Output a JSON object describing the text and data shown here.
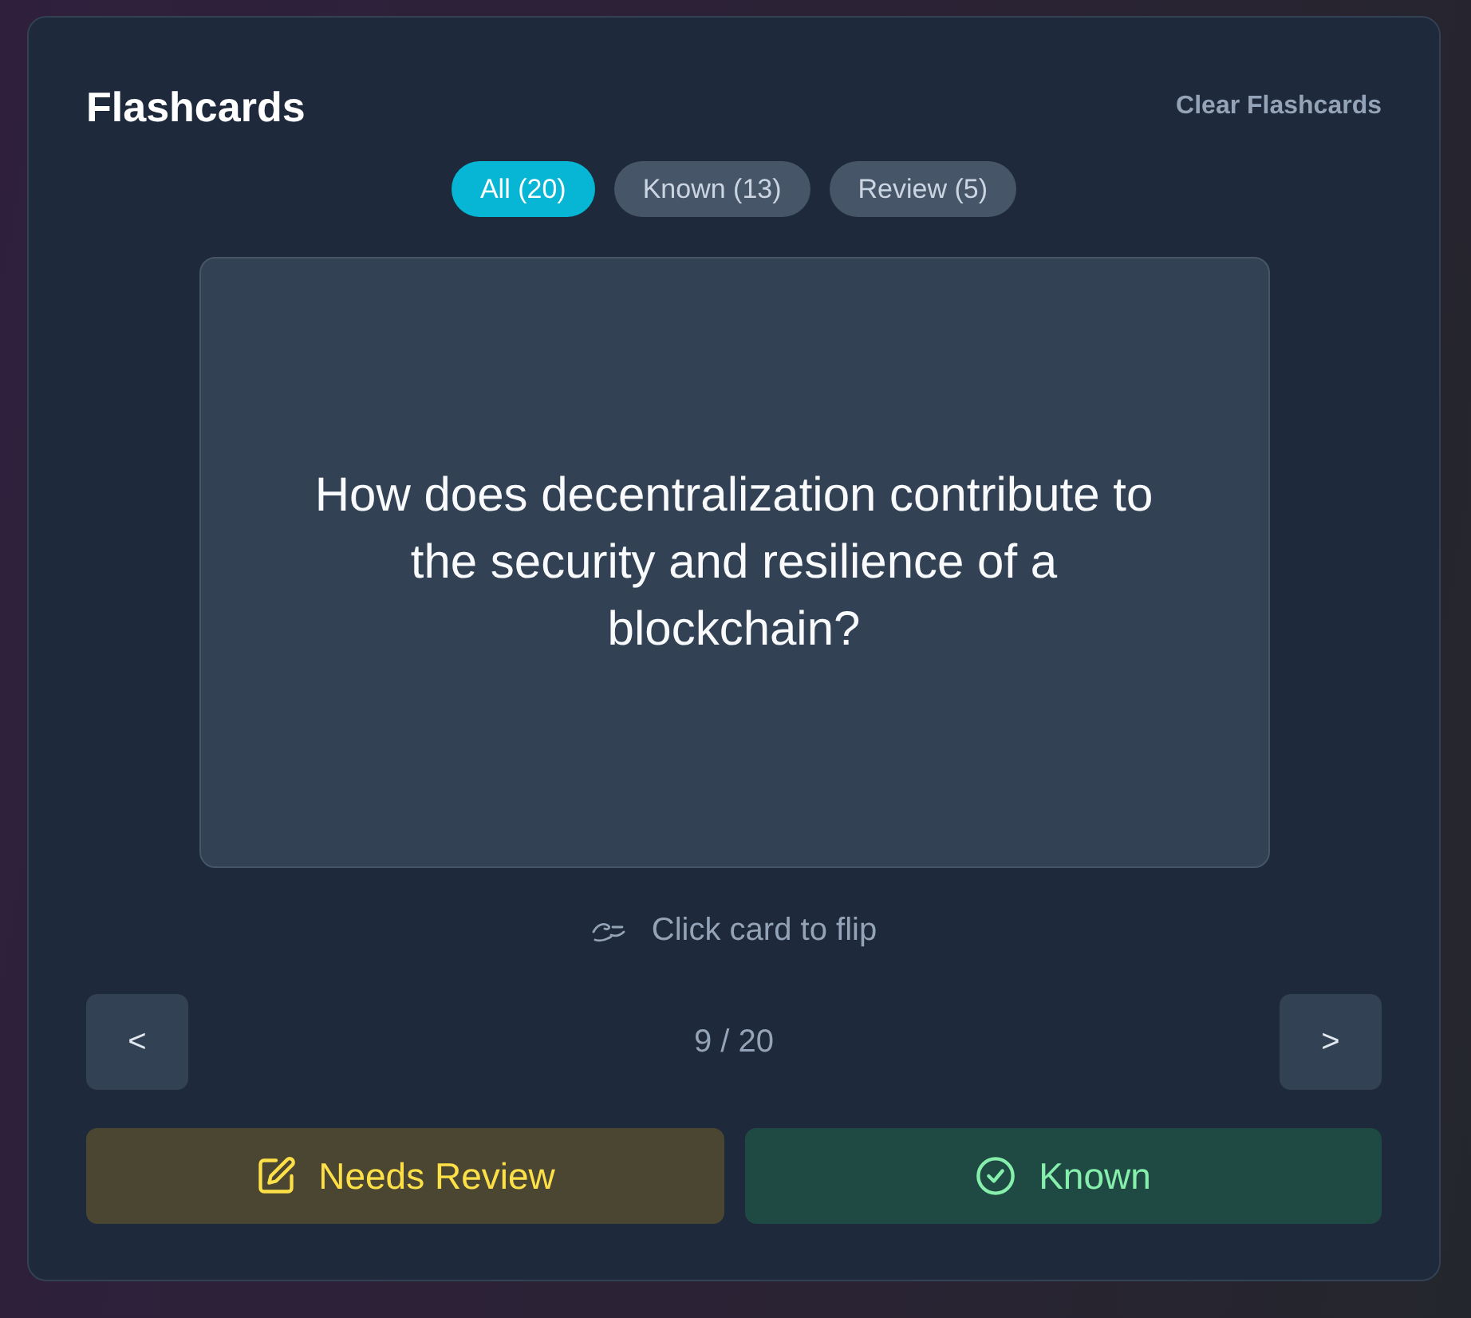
{
  "header": {
    "title": "Flashcards",
    "clear_button": "Clear Flashcards"
  },
  "filters": [
    {
      "label": "All (20)",
      "selected": true
    },
    {
      "label": "Known (13)",
      "selected": false
    },
    {
      "label": "Review (5)",
      "selected": false
    }
  ],
  "card": {
    "question": "How does decentralization contribute to the security and resilience of a blockchain?"
  },
  "flip_hint": "Click card to flip",
  "navigation": {
    "previous": "<",
    "counter": "9 / 20",
    "next": ">"
  },
  "actions": [
    {
      "kind": "review",
      "label": "Needs Review"
    },
    {
      "kind": "known",
      "label": "Known"
    }
  ]
}
